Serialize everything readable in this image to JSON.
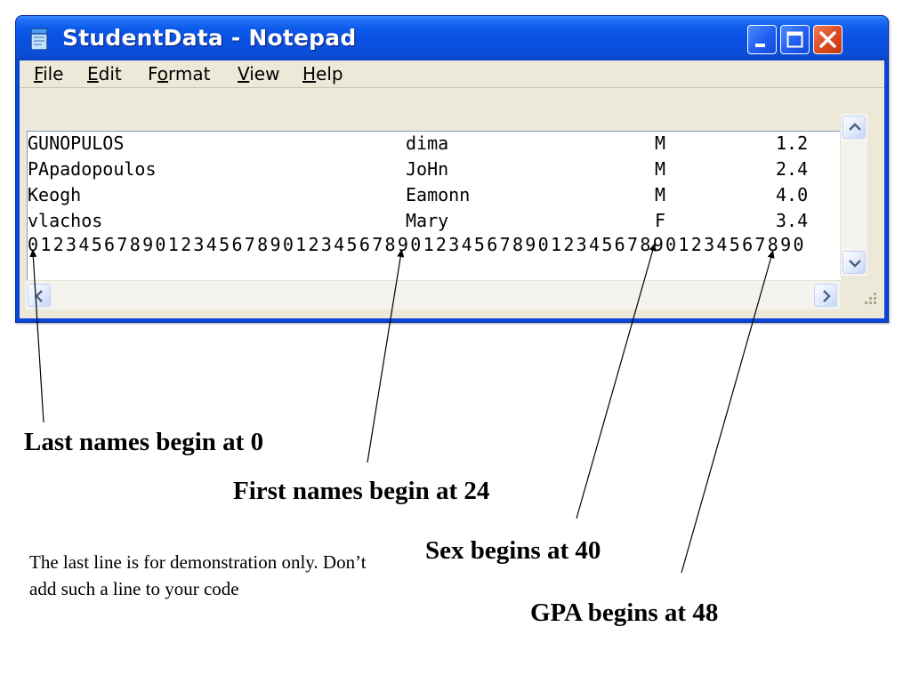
{
  "window": {
    "title": "StudentData - Notepad",
    "icon": "notepad-icon",
    "controls": [
      "minimize-icon",
      "maximize-icon",
      "close-icon"
    ]
  },
  "menu": [
    {
      "prefix": "",
      "key": "F",
      "rest": "ile"
    },
    {
      "prefix": "",
      "key": "E",
      "rest": "dit"
    },
    {
      "prefix": "F",
      "key": "o",
      "rest": "rmat"
    },
    {
      "prefix": "",
      "key": "V",
      "rest": "iew"
    },
    {
      "prefix": "",
      "key": "H",
      "rest": "elp"
    }
  ],
  "records": [
    {
      "last": "GUNOPULOS",
      "first": "dima",
      "sex": "M",
      "gpa": "1.2"
    },
    {
      "last": "PApadopoulos",
      "first": "JoHn",
      "sex": "M",
      "gpa": "2.4"
    },
    {
      "last": "Keogh",
      "first": "Eamonn",
      "sex": "M",
      "gpa": "4.0"
    },
    {
      "last": "vlachos",
      "first": "Mary",
      "sex": "F",
      "gpa": "3.4"
    }
  ],
  "ruler": "0123456789012345678901234567890123456789012345678901234567890",
  "labels": {
    "last": "Last names begin at 0",
    "first": "First names begin at 24",
    "sex": "Sex begins at 40",
    "gpa": "GPA begins at 48"
  },
  "note": "The last line is for demonstration only. Don’t add such a line to your code"
}
